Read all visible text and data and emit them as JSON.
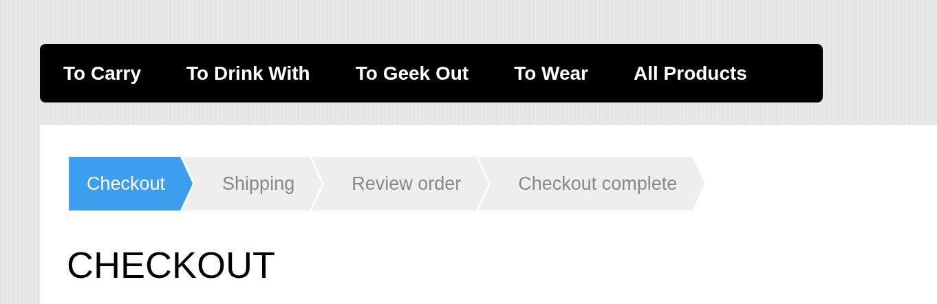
{
  "nav": [
    {
      "label": "To Carry"
    },
    {
      "label": "To Drink With"
    },
    {
      "label": "To Geek Out"
    },
    {
      "label": "To Wear"
    },
    {
      "label": "All Products"
    }
  ],
  "steps": [
    {
      "label": "Checkout",
      "selected": true
    },
    {
      "label": "Shipping",
      "selected": false
    },
    {
      "label": "Review order",
      "selected": false
    },
    {
      "label": "Checkout complete",
      "selected": false
    }
  ],
  "heading": "CHECKOUT"
}
